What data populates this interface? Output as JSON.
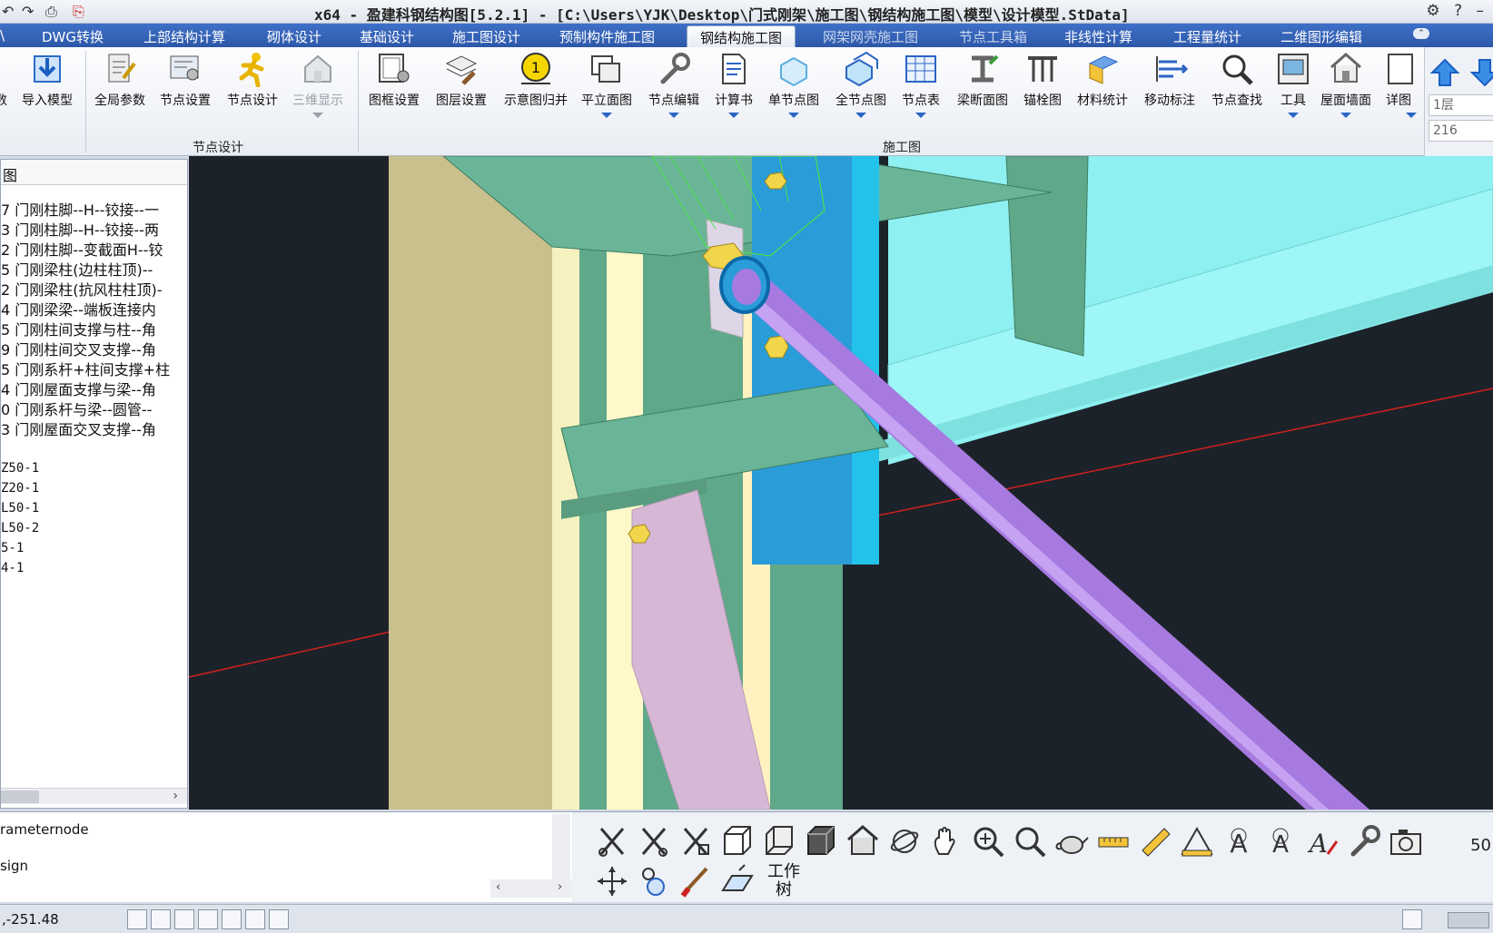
{
  "window": {
    "title": "x64 - 盈建科钢结构图[5.2.1] - [C:\\Users\\YJK\\Desktop\\门式刚架\\施工图\\钢结构施工图\\模型\\设计模型.StData]"
  },
  "tabs": [
    {
      "label": "DWG转换"
    },
    {
      "label": "上部结构计算"
    },
    {
      "label": "砌体设计"
    },
    {
      "label": "基础设计"
    },
    {
      "label": "施工图设计"
    },
    {
      "label": "预制构件施工图"
    },
    {
      "label": "钢结构施工图"
    },
    {
      "label": "网架网壳施工图"
    },
    {
      "label": "节点工具箱"
    },
    {
      "label": "非线性计算"
    },
    {
      "label": "工程量统计"
    },
    {
      "label": "二维图形编辑"
    }
  ],
  "ribbon": {
    "buttons": [
      {
        "label": "导入模型"
      },
      {
        "label": "全局参数"
      },
      {
        "label": "节点设置"
      },
      {
        "label": "节点设计"
      },
      {
        "label": "三维显示"
      },
      {
        "label": "图框设置"
      },
      {
        "label": "图层设置"
      },
      {
        "label": "示意图归并",
        "badge": "1"
      },
      {
        "label": "平立面图"
      },
      {
        "label": "节点编辑"
      },
      {
        "label": "计算书"
      },
      {
        "label": "单节点图"
      },
      {
        "label": "全节点图"
      },
      {
        "label": "节点表"
      },
      {
        "label": "梁断面图"
      },
      {
        "label": "锚栓图"
      },
      {
        "label": "材料统计"
      },
      {
        "label": "移动标注"
      },
      {
        "label": "节点查找"
      },
      {
        "label": "工具"
      },
      {
        "label": "屋面墙面"
      },
      {
        "label": "详图"
      }
    ],
    "partial_left_label": "数",
    "groups": [
      {
        "label": "节点设计"
      },
      {
        "label": "施工图"
      }
    ],
    "right_fields": {
      "floor": "1层",
      "value": "216"
    }
  },
  "left_panel": {
    "header": "图",
    "items": [
      "7 门刚柱脚--H--铰接--一",
      "3 门刚柱脚--H--铰接--两",
      "2 门刚柱脚--变截面H--铰",
      "5 门刚梁柱(边柱柱顶)--",
      "2 门刚梁柱(抗风柱柱顶)-",
      "4 门刚梁梁--端板连接内",
      "5 门刚柱间支撑与柱--角",
      "9 门刚柱间交叉支撑--角",
      "5 门刚系杆+柱间支撑+柱",
      "4 门刚屋面支撑与梁--角",
      "0 门刚系杆与梁--圆管--",
      "3 门刚屋面交叉支撑--角"
    ],
    "codes": [
      "Z50-1",
      "Z20-1",
      "L50-1",
      "L50-2",
      "5-1",
      "4-1"
    ]
  },
  "command": {
    "lines": [
      "rameternode",
      "sign"
    ]
  },
  "view_toolbar": {
    "worktree_label": "工作树",
    "number": "50"
  },
  "status": {
    "coordinate": ",-251.48"
  },
  "colors": {
    "tab_bar": "#3566bd",
    "viewport_bg": "#1c2229",
    "column": "#c9c08e",
    "plate_green": "#5fa889",
    "beam_cyan": "#8ef0f0",
    "rod_purple": "#a77ae0",
    "brace_pink": "#d6b8d6",
    "bolt_yellow": "#f1d54a",
    "axis_red": "#d02020"
  }
}
